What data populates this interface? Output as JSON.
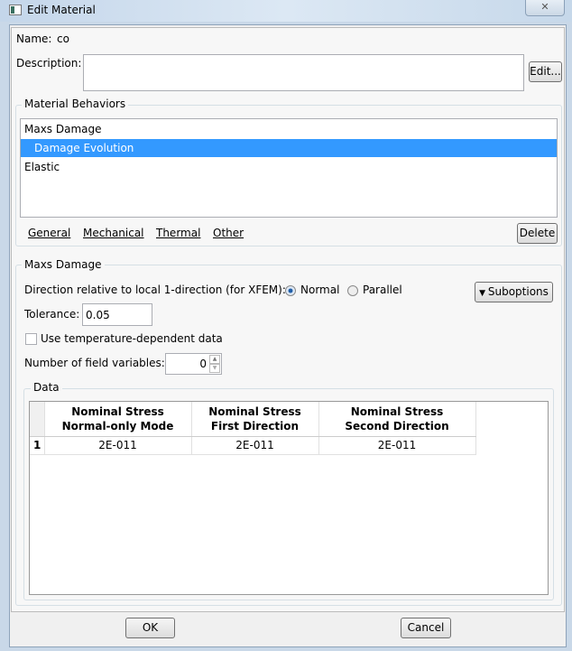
{
  "window": {
    "title": "Edit Material",
    "close_icon": "close-icon"
  },
  "name": {
    "label": "Name:",
    "value": "co"
  },
  "description": {
    "label": "Description:",
    "value": "",
    "edit_label": "Edit..."
  },
  "behaviors": {
    "title": "Material Behaviors",
    "items": [
      {
        "label": "Maxs Damage"
      },
      {
        "label": "Damage Evolution",
        "selected": true
      },
      {
        "label": "Elastic"
      }
    ],
    "menus": [
      "General",
      "Mechanical",
      "Thermal",
      "Other"
    ],
    "delete_label": "Delete"
  },
  "section": {
    "title": "Maxs Damage",
    "direction_label": "Direction relative to local 1-direction (for XFEM):",
    "options": [
      "Normal",
      "Parallel"
    ],
    "selected_option": "Normal",
    "suboptions_label": "Suboptions",
    "tolerance_label": "Tolerance:",
    "tolerance_value": "0.05",
    "temp_label": "Use temperature-dependent data",
    "temp_checked": false,
    "fieldvars_label": "Number of field variables:",
    "fieldvars_value": "0"
  },
  "data": {
    "title": "Data",
    "columns": [
      [
        "Nominal Stress",
        "Normal-only Mode"
      ],
      [
        "Nominal Stress",
        "First Direction"
      ],
      [
        "Nominal Stress",
        "Second Direction"
      ]
    ],
    "rows": [
      {
        "index": "1",
        "values": [
          "2E-011",
          "2E-011",
          "2E-011"
        ]
      }
    ]
  },
  "footer": {
    "ok_label": "OK",
    "cancel_label": "Cancel"
  },
  "colors": {
    "selection": "#3399ff"
  }
}
